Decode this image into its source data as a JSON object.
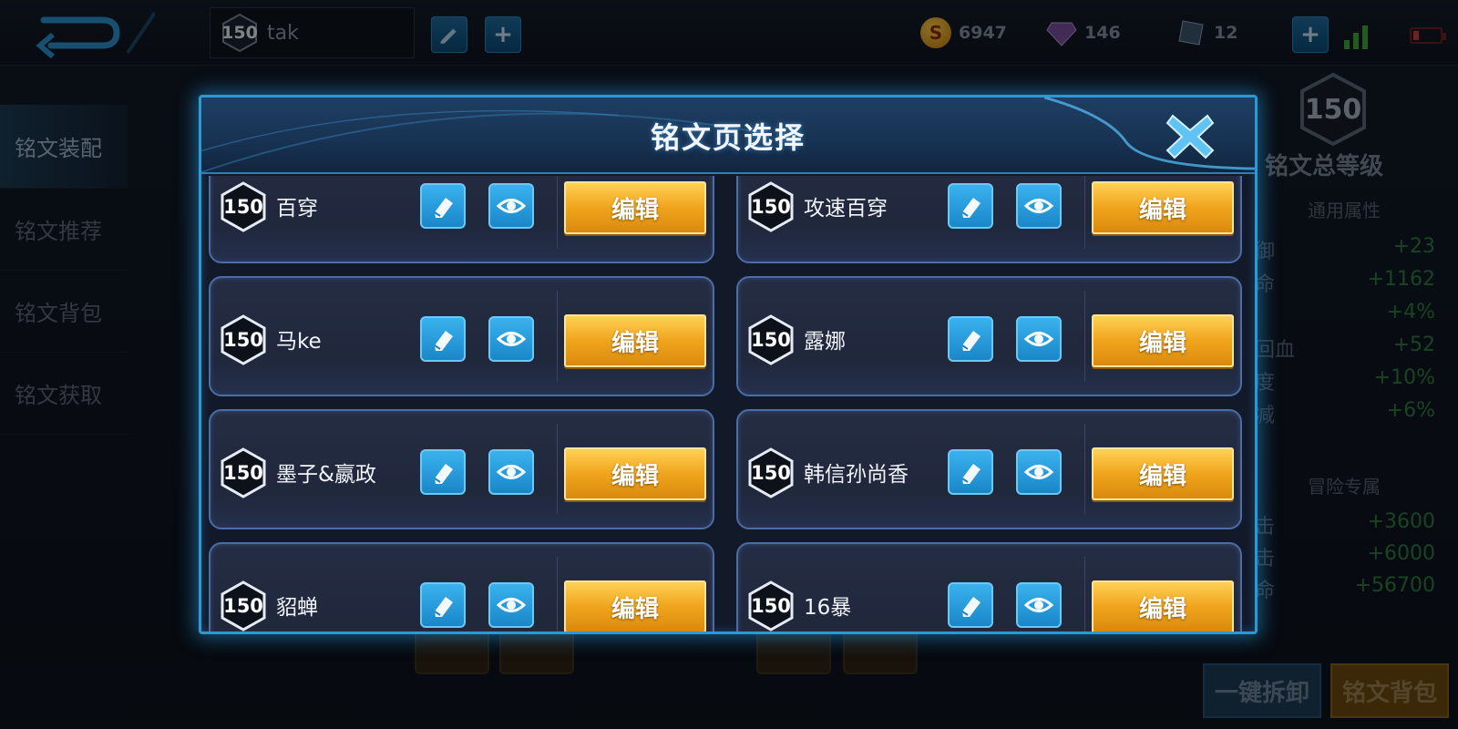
{
  "topbar": {
    "player_level": "150",
    "player_name": "tak",
    "currencies": [
      {
        "icon": "gold-coin-icon",
        "value": "6947"
      },
      {
        "icon": "diamond-icon",
        "value": "146"
      },
      {
        "icon": "voucher-icon",
        "value": "12"
      }
    ]
  },
  "left_nav": {
    "items": [
      {
        "label": "铭文装配",
        "active": true
      },
      {
        "label": "铭文推荐",
        "active": false
      },
      {
        "label": "铭文背包",
        "active": false
      },
      {
        "label": "铭文获取",
        "active": false
      }
    ]
  },
  "right_panel": {
    "level": "150",
    "title": "铭文总等级",
    "general_header": "通用属性",
    "general": [
      {
        "k": "防御",
        "v": "+23"
      },
      {
        "k": "生命",
        "v": "+1162"
      },
      {
        "k": "",
        "v": "+4%"
      },
      {
        "k": "秒回血",
        "v": "+52"
      },
      {
        "k": "速度",
        "v": "+10%"
      },
      {
        "k": "缩减",
        "v": "+6%"
      }
    ],
    "adventure_header": "冒险专属",
    "adventure": [
      {
        "k": "攻击",
        "v": "+3600"
      },
      {
        "k": "攻击",
        "v": "+6000"
      },
      {
        "k": "生命",
        "v": "+56700"
      }
    ],
    "unload_label": "一键拆卸",
    "bag_label": "铭文背包"
  },
  "modal": {
    "title": "铭文页选择",
    "edit_label": "编辑",
    "pages": [
      {
        "level": "150",
        "name": "百穿"
      },
      {
        "level": "150",
        "name": "攻速百穿"
      },
      {
        "level": "150",
        "name": "马ke"
      },
      {
        "level": "150",
        "name": "露娜"
      },
      {
        "level": "150",
        "name": "墨子&嬴政"
      },
      {
        "level": "150",
        "name": "韩信孙尚香"
      },
      {
        "level": "150",
        "name": "貂蝉"
      },
      {
        "level": "150",
        "name": "16暴"
      }
    ]
  },
  "colors": {
    "accent_blue": "#2a9ad6",
    "edit_gold": "#f0a41c",
    "bonus_green": "#2f7d3f"
  }
}
